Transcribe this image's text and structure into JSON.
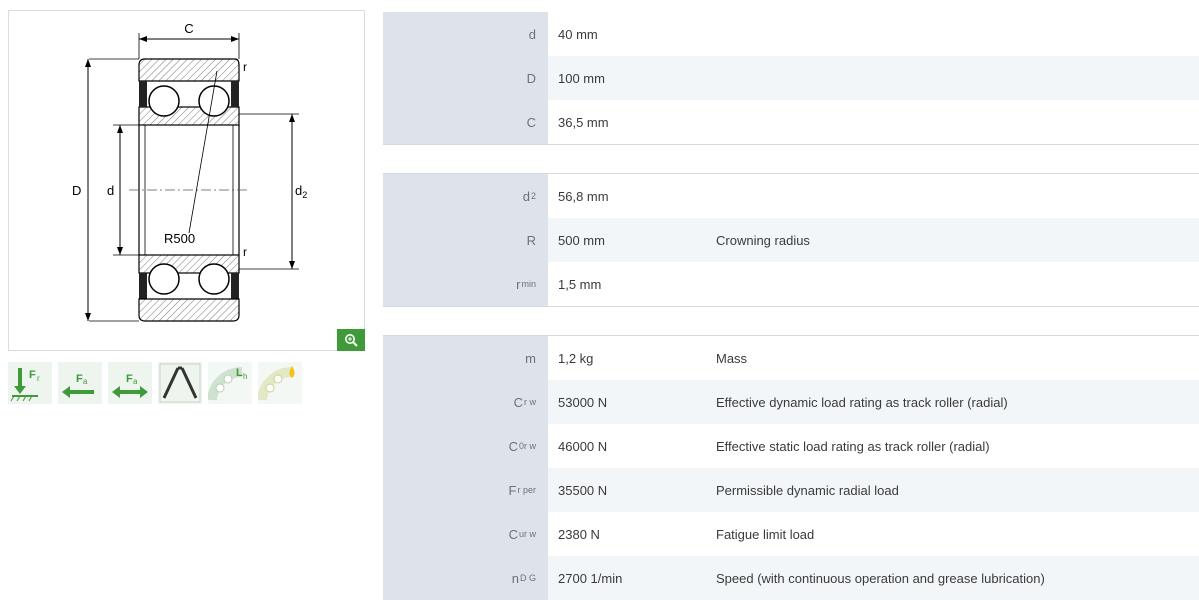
{
  "drawing": {
    "labels": {
      "C": "C",
      "r_top": "r",
      "r_bottom": "r",
      "D": "D",
      "d": "d",
      "d2_main": "d",
      "d2_sub": "2",
      "R500": "R500"
    }
  },
  "toolbar_icons": [
    {
      "name": "radial-load-icon",
      "label_main": "F",
      "label_sub": "r"
    },
    {
      "name": "axial-load-left-icon",
      "label_main": "F",
      "label_sub": "a"
    },
    {
      "name": "axial-load-both-icon",
      "label_main": "F",
      "label_sub": "a"
    },
    {
      "name": "angle-icon"
    },
    {
      "name": "life-icon",
      "label_main": "L",
      "label_sub": "h"
    },
    {
      "name": "lubrication-icon"
    }
  ],
  "colors": {
    "accent_green": "#3f9a3a",
    "symbol_bg": "#dde3e9",
    "alt_row": "#f3f6f9"
  },
  "groups": [
    {
      "rows": [
        {
          "sym": "d",
          "sub": "",
          "val": "40  mm",
          "desc": ""
        },
        {
          "sym": "D",
          "sub": "",
          "val": "100  mm",
          "desc": ""
        },
        {
          "sym": "C",
          "sub": "",
          "val": "36,5  mm",
          "desc": ""
        }
      ]
    },
    {
      "rows": [
        {
          "sym": "d",
          "sub": "2",
          "val": "56,8  mm",
          "desc": ""
        },
        {
          "sym": "R",
          "sub": "",
          "val": "500  mm",
          "desc": "Crowning radius"
        },
        {
          "sym": "r",
          "sub": "min",
          "val": "1,5  mm",
          "desc": ""
        }
      ]
    },
    {
      "rows": [
        {
          "sym": "m",
          "sub": "",
          "val": "1,2  kg",
          "desc": "Mass"
        },
        {
          "sym": "C",
          "sub": "r w",
          "val": "53000  N",
          "desc": "Effective dynamic load rating as track roller (radial)"
        },
        {
          "sym": "C",
          "sub": "0r w",
          "val": "46000  N",
          "desc": "Effective static load rating as track roller (radial)"
        },
        {
          "sym": "F",
          "sub": "r per",
          "val": "35500  N",
          "desc": "Permissible dynamic radial load"
        },
        {
          "sym": "C",
          "sub": "ur w",
          "val": "2380  N",
          "desc": "Fatigue limit load"
        },
        {
          "sym": "n",
          "sub": "D G",
          "val": "2700  1/min",
          "desc": "Speed (with continuous operation and grease lubrication)"
        }
      ]
    }
  ]
}
